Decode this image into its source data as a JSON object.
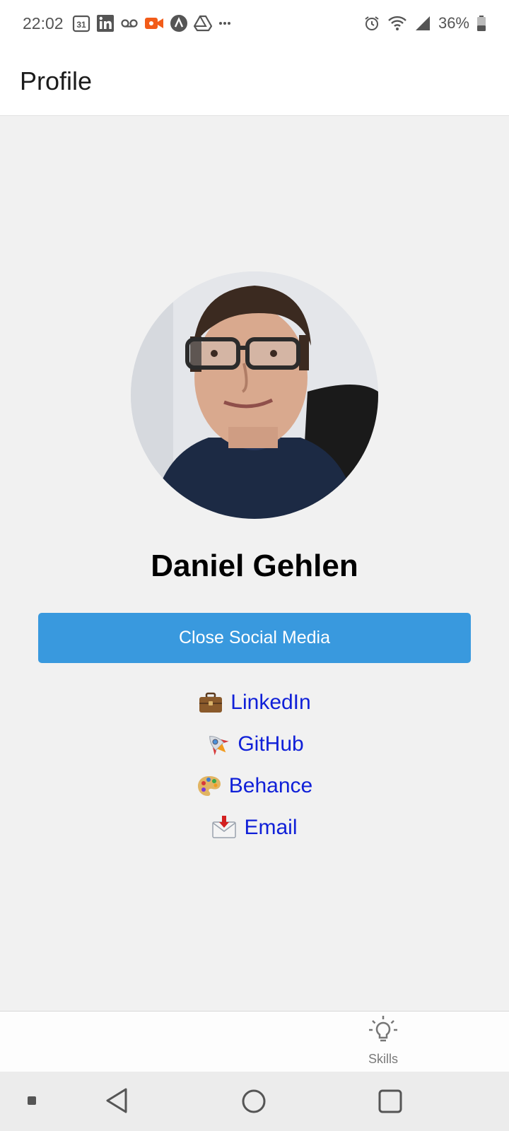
{
  "status_bar": {
    "time": "22:02",
    "calendar_day": "31",
    "battery": "36%",
    "left_icons": [
      "calendar-icon",
      "linkedin-icon",
      "voicemail-icon",
      "video-call-icon",
      "app-icon",
      "drive-icon",
      "more-icon"
    ],
    "right_icons": [
      "alarm-icon",
      "wifi-icon",
      "signal-icon",
      "battery-icon"
    ]
  },
  "header": {
    "title": "Profile"
  },
  "profile": {
    "name": "Daniel Gehlen",
    "toggle_label": "Close Social Media"
  },
  "social": [
    {
      "icon": "briefcase-icon",
      "label": "LinkedIn"
    },
    {
      "icon": "rocket-icon",
      "label": "GitHub"
    },
    {
      "icon": "palette-icon",
      "label": "Behance"
    },
    {
      "icon": "envelope-icon",
      "label": "Email"
    }
  ],
  "tabs": [
    {
      "icon": "lightbulb-icon",
      "label": "Skills"
    }
  ],
  "colors": {
    "accent": "#3999de",
    "link": "#1020d8",
    "background": "#f1f1f1"
  }
}
